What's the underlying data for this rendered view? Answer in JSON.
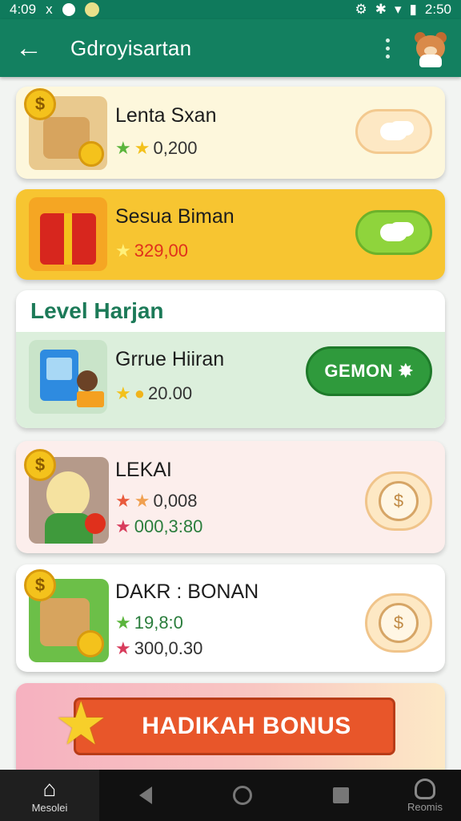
{
  "status_bar": {
    "time_left": "4:09",
    "glyph_x": "x",
    "time_right": "2:50"
  },
  "app_bar": {
    "back_icon": "arrow-left-icon",
    "title": "Gdroyisartan",
    "more_icon": "more-vert-icon",
    "avatar_icon": "bear-avatar-icon"
  },
  "cards": [
    {
      "name": "Lenta Sxan",
      "stat1": "0,200",
      "button_icon": "cloud-icon"
    },
    {
      "name": "Sesua Biman",
      "stat1": "329,00",
      "button_icon": "cloud-icon"
    },
    {
      "name": "Grrue Hiiran",
      "stat1": "20.00",
      "button_label": "GEMON"
    },
    {
      "name": "LEKAI",
      "stat1": "0,008",
      "stat2": "000,3:80",
      "button_icon": "coin-bubble-icon"
    },
    {
      "name": "DAKR : BONAN",
      "stat1": "19,8:0",
      "stat2": "300,0.30",
      "button_icon": "coin-bubble-icon"
    }
  ],
  "section": {
    "title": "Level Harjan"
  },
  "bonus": {
    "label": "HADIKAH BONUS"
  },
  "nav": {
    "home_label": "Mesolei",
    "profile_label": "Reomis"
  },
  "colors": {
    "primary": "#138060",
    "accent_yellow": "#f7c531",
    "accent_green": "#2f9a3c",
    "accent_orange": "#e8562a"
  }
}
